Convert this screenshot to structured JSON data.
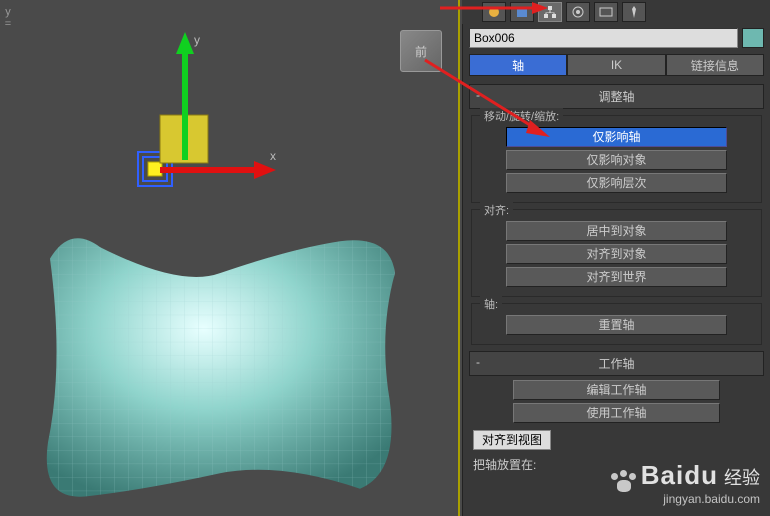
{
  "viewport": {
    "y_marker_label": "y",
    "cube_face": "前",
    "gizmo_axes": {
      "x": "x",
      "y": "y"
    }
  },
  "selected_object_name": "Box006",
  "mode_buttons": {
    "pivot": "轴",
    "ik": "IK",
    "link": "链接信息"
  },
  "rollout_adjust_pivot": {
    "title": "调整轴",
    "group_move": {
      "label": "移动/旋转/缩放:",
      "affect_pivot_only": "仅影响轴",
      "affect_object_only": "仅影响对象",
      "affect_hierarchy_only": "仅影响层次"
    },
    "group_align": {
      "label": "对齐:",
      "center_to_object": "居中到对象",
      "align_to_object": "对齐到对象",
      "align_to_world": "对齐到世界"
    },
    "group_pivot": {
      "label": "轴:",
      "reset_pivot": "重置轴"
    }
  },
  "rollout_working_pivot": {
    "title": "工作轴",
    "edit_working_pivot": "编辑工作轴",
    "use_working_pivot": "使用工作轴",
    "align_to_view": "对齐到视图",
    "place_pivot_to": "把轴放置在:"
  },
  "watermark": {
    "brand": "Baidu",
    "cn": "经验",
    "url": "jingyan.baidu.com"
  }
}
